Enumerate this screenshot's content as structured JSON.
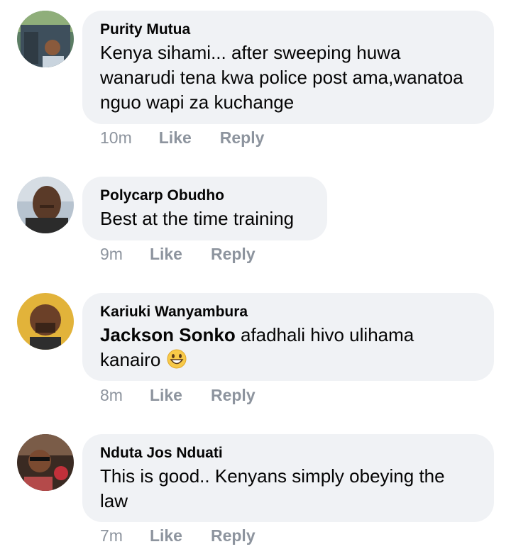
{
  "comments": [
    {
      "author": "Purity Mutua",
      "text": "Kenya sihami... after sweeping huwa wanarudi tena kwa police post ama,wanatoa nguo wapi za kuchange",
      "time": "10m",
      "like_label": "Like",
      "reply_label": "Reply"
    },
    {
      "author": "Polycarp Obudho",
      "text": "Best at the time training",
      "time": "9m",
      "like_label": "Like",
      "reply_label": "Reply"
    },
    {
      "author": "Kariuki Wanyambura",
      "mention": "Jackson Sonko",
      "text": " afadhali hivo ulihama kanairo",
      "emoji": "grinning-face-icon",
      "time": "8m",
      "like_label": "Like",
      "reply_label": "Reply"
    },
    {
      "author": "Nduta Jos Nduati",
      "text": "This is good.. Kenyans simply obeying the law",
      "time": "7m",
      "like_label": "Like",
      "reply_label": "Reply"
    }
  ],
  "colors": {
    "bubble_bg": "#f0f2f5",
    "meta_text": "#8d949e",
    "primary_text": "#050505"
  }
}
